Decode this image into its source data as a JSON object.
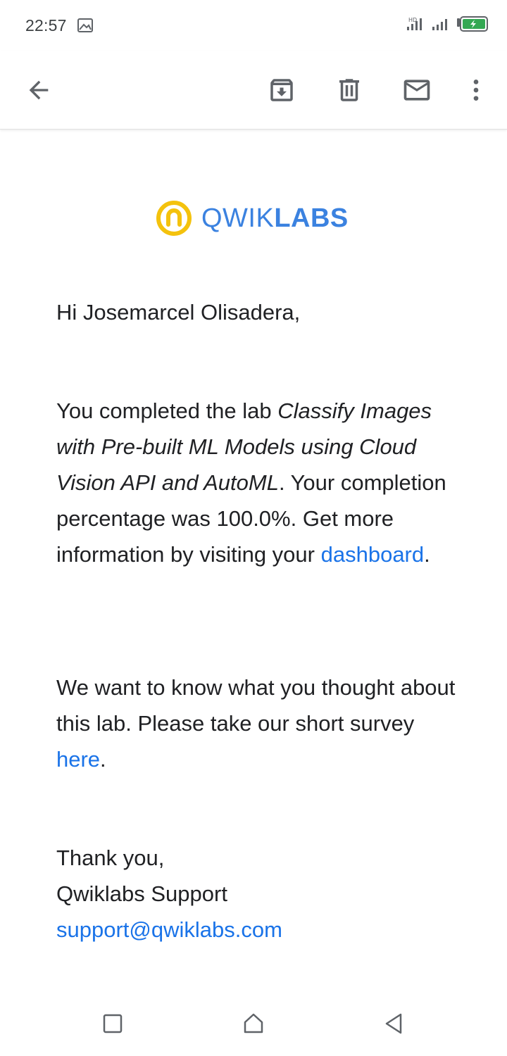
{
  "status_bar": {
    "time": "22:57",
    "icons": [
      "image-icon",
      "signal-hd-icon",
      "signal-icon",
      "battery-charging-icon"
    ]
  },
  "toolbar": {
    "icons": [
      "arrow-back-icon",
      "archive-icon",
      "delete-icon",
      "mark-unread-icon",
      "more-vert-icon"
    ]
  },
  "email": {
    "logo": {
      "word_light": "QWIK",
      "word_bold": "LABS",
      "ring_color": "#f4c20d",
      "text_color": "#3b82e0"
    },
    "greeting": "Hi Josemarcel Olisadera,",
    "completed": {
      "text_before": "You completed the lab ",
      "lab_name": "Classify Images with Pre-built ML Models using Cloud Vision API and AutoML",
      "text_after": ". Your completion percentage was 100.0%. Get more information by visiting your ",
      "link": "dashboard",
      "end": "."
    },
    "survey": {
      "text_before": "We want to know what you thought about this lab. Please take our short survey ",
      "link": "here",
      "end": "."
    },
    "signoff": {
      "thanks": "Thank you,",
      "team": "Qwiklabs Support",
      "email": "support@qwiklabs.com"
    },
    "link_color": "#1a73e8"
  },
  "nav_bar": {
    "icons": [
      "recent-apps-icon",
      "home-icon",
      "back-icon"
    ]
  }
}
